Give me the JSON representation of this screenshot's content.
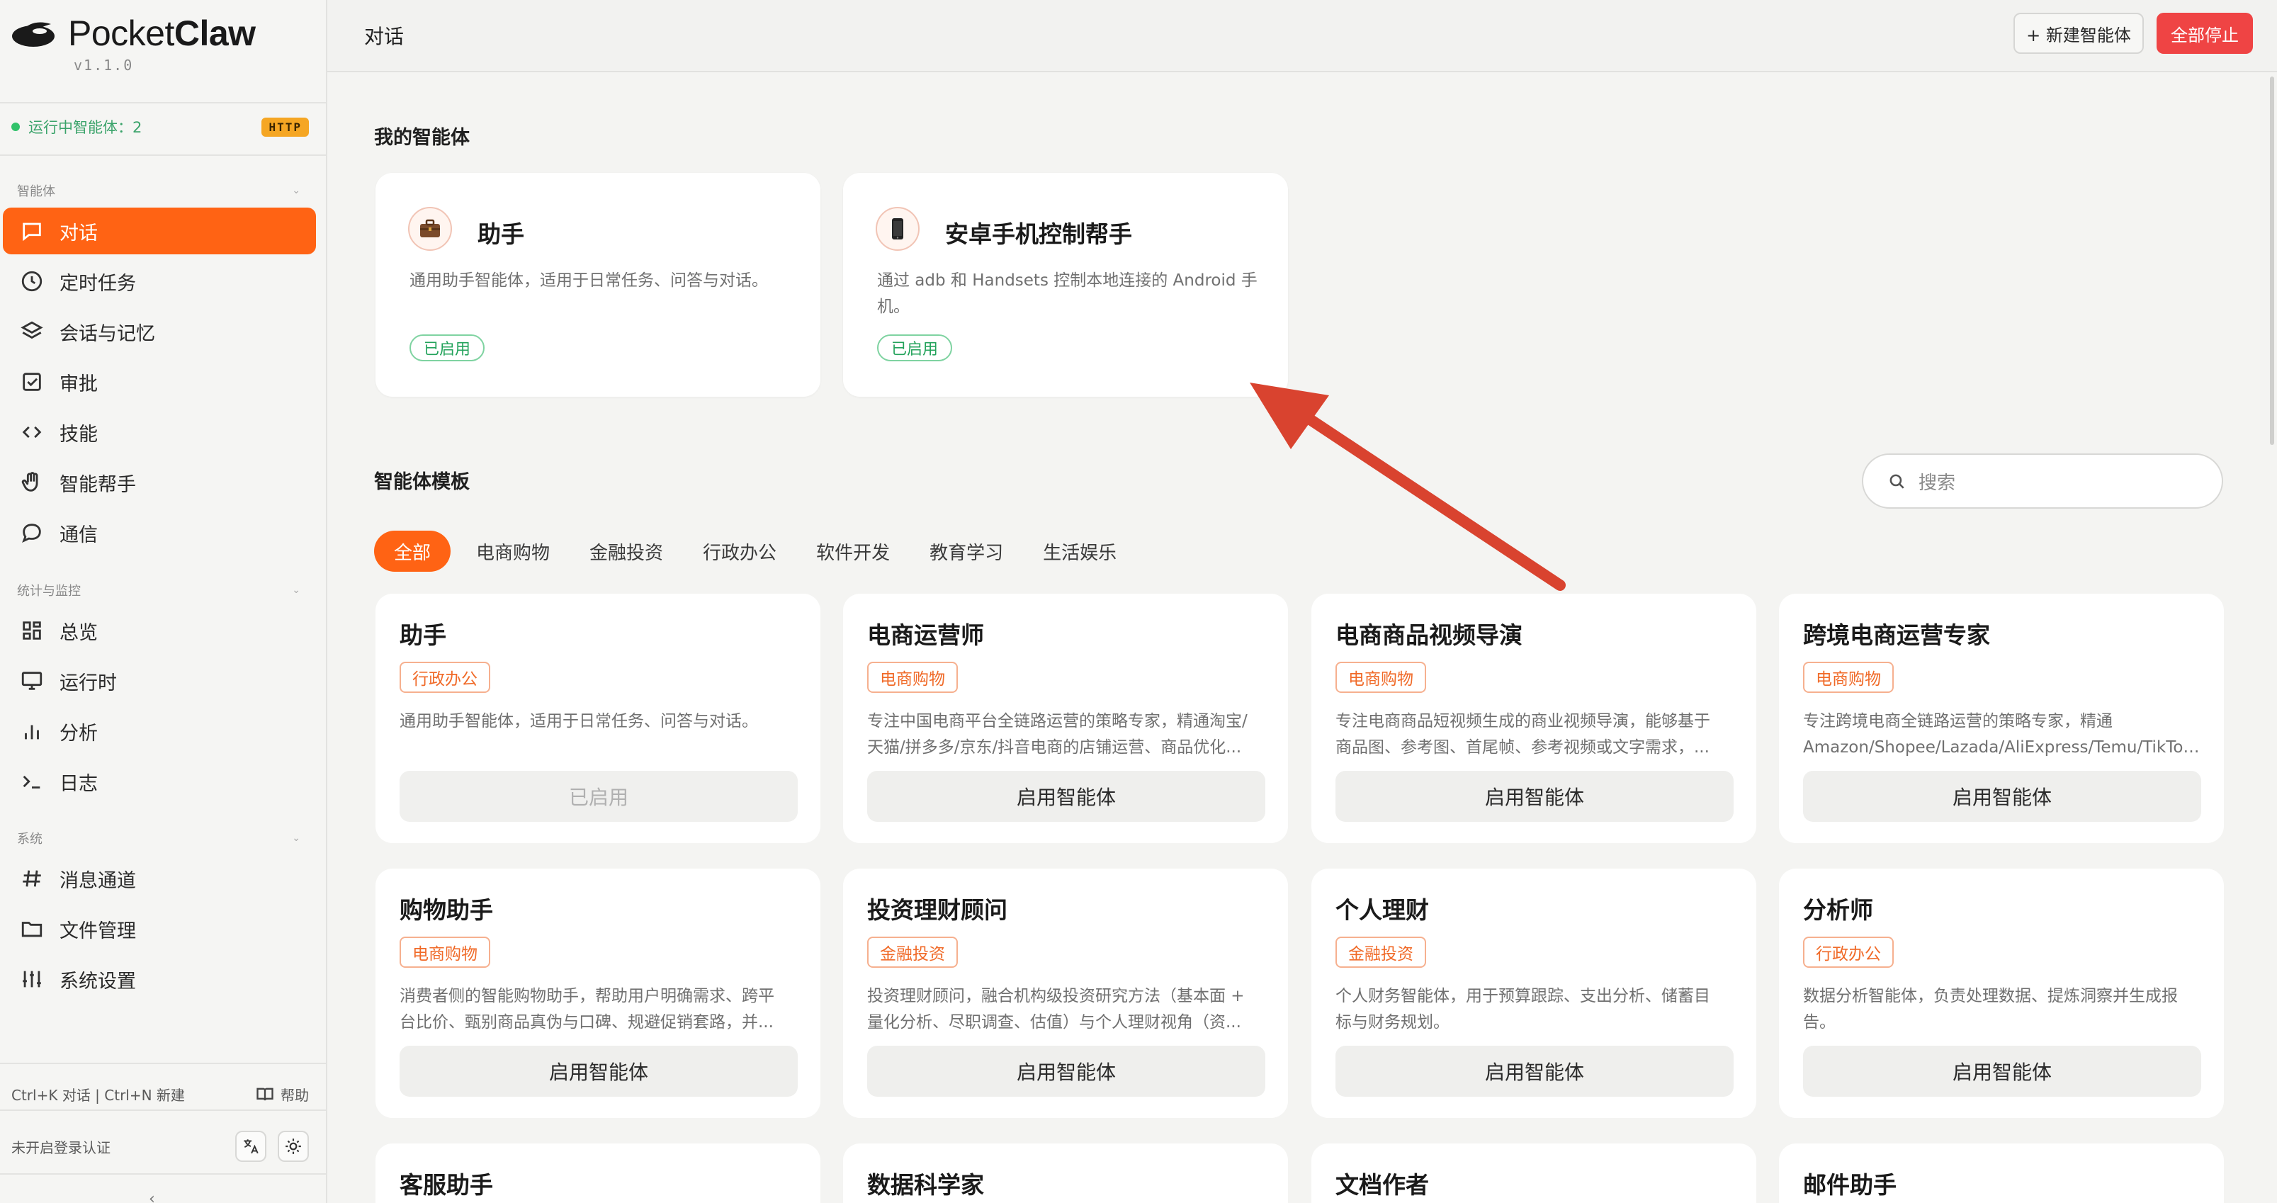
{
  "app": {
    "name_regular": "Pocket",
    "name_bold": "Claw",
    "version": "v1.1.0"
  },
  "status": {
    "running_label": "运行中智能体：2",
    "protocol_badge": "HTTP"
  },
  "sidebar": {
    "sections": [
      {
        "label": "智能体"
      },
      {
        "label": "统计与监控"
      },
      {
        "label": "系统"
      }
    ],
    "items": [
      {
        "label": "对话",
        "icon": "chat-icon"
      },
      {
        "label": "定时任务",
        "icon": "clock-icon"
      },
      {
        "label": "会话与记忆",
        "icon": "layers-icon"
      },
      {
        "label": "审批",
        "icon": "checkbox-icon"
      },
      {
        "label": "技能",
        "icon": "code-icon"
      },
      {
        "label": "智能帮手",
        "icon": "hand-icon"
      },
      {
        "label": "通信",
        "icon": "message-icon"
      },
      {
        "label": "总览",
        "icon": "grid-icon"
      },
      {
        "label": "运行时",
        "icon": "monitor-icon"
      },
      {
        "label": "分析",
        "icon": "bar-chart-icon"
      },
      {
        "label": "日志",
        "icon": "terminal-icon"
      },
      {
        "label": "消息通道",
        "icon": "hash-icon"
      },
      {
        "label": "文件管理",
        "icon": "folder-icon"
      },
      {
        "label": "系统设置",
        "icon": "sliders-icon"
      }
    ],
    "shortcut_hint": "Ctrl+K 对话 | Ctrl+N 新建",
    "help_label": "帮助",
    "auth_status": "未开启登录认证"
  },
  "header": {
    "title": "对话",
    "new_agent_label": "+ 新建智能体",
    "stop_all_label": "全部停止"
  },
  "my_agents": {
    "title": "我的智能体",
    "cards": [
      {
        "name": "助手",
        "icon": "briefcase-icon",
        "desc": "通用助手智能体，适用于日常任务、问答与对话。",
        "status": "已启用"
      },
      {
        "name": "安卓手机控制帮手",
        "icon": "phone-icon",
        "desc": "通过 adb 和 Handsets 控制本地连接的 Android 手机。",
        "status": "已启用"
      }
    ]
  },
  "templates": {
    "title": "智能体模板",
    "search_placeholder": "搜索",
    "tabs": [
      "全部",
      "电商购物",
      "金融投资",
      "行政办公",
      "软件开发",
      "教育学习",
      "生活娱乐"
    ],
    "cards": [
      {
        "name": "助手",
        "tag": "行政办公",
        "desc1": "通用助手智能体，适用于日常任务、问答与对话。",
        "desc2": "",
        "button": "已启用"
      },
      {
        "name": "电商运营师",
        "tag": "电商购物",
        "desc1": "专注中国电商平台全链路运营的策略专家，精通淘宝/",
        "desc2": "天猫/拼多多/京东/抖音电商的店铺运营、商品优化...",
        "button": "启用智能体"
      },
      {
        "name": "电商商品视频导演",
        "tag": "电商购物",
        "desc1": "专注电商商品短视频生成的商业视频导演，能够基于",
        "desc2": "商品图、参考图、首尾帧、参考视频或文字需求，...",
        "button": "启用智能体"
      },
      {
        "name": "跨境电商运营专家",
        "tag": "电商购物",
        "desc1": "专注跨境电商全链路运营的策略专家，精通",
        "desc2": "Amazon/Shopee/Lazada/AliExpress/Temu/TikTok...",
        "button": "启用智能体"
      },
      {
        "name": "购物助手",
        "tag": "电商购物",
        "desc1": "消费者侧的智能购物助手，帮助用户明确需求、跨平",
        "desc2": "台比价、甄别商品真伪与口碑、规避促销套路，并...",
        "button": "启用智能体"
      },
      {
        "name": "投资理财顾问",
        "tag": "金融投资",
        "desc1": "投资理财顾问，融合机构级投资研究方法（基本面 +",
        "desc2": "量化分析、尽职调查、估值）与个人理财视角（资...",
        "button": "启用智能体"
      },
      {
        "name": "个人理财",
        "tag": "金融投资",
        "desc1": "个人财务智能体，用于预算跟踪、支出分析、储蓄目",
        "desc2": "标与财务规划。",
        "button": "启用智能体"
      },
      {
        "name": "分析师",
        "tag": "行政办公",
        "desc1": "数据分析智能体，负责处理数据、提炼洞察并生成报",
        "desc2": "告。",
        "button": "启用智能体"
      },
      {
        "name": "客服助手"
      },
      {
        "name": "数据科学家"
      },
      {
        "name": "文档作者"
      },
      {
        "name": "邮件助手"
      }
    ]
  },
  "colors": {
    "accent": "#ff6314",
    "stop": "#ef4444",
    "enabled": "#22a25a",
    "annotation_arrow": "#d9432f"
  }
}
